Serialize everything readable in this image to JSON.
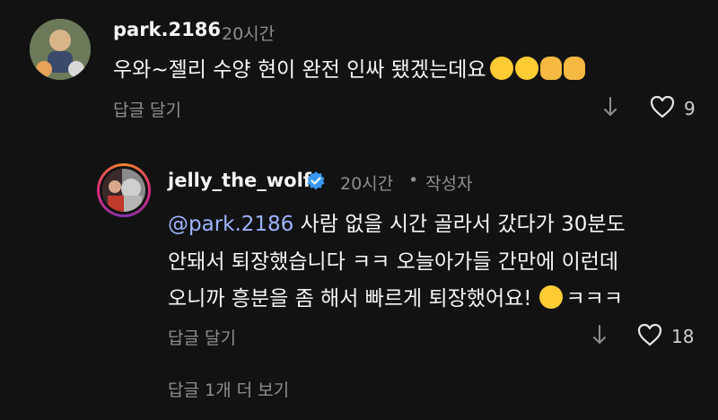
{
  "comment1": {
    "username": "park.2186",
    "time": "20시간",
    "text": "우와~젤리 수양 현이 완전 인싸 됐겠는데요",
    "emojis": [
      "heart-eyes-emoji",
      "heart-eyes-emoji",
      "clapping-hands-emoji",
      "clapping-hands-emoji"
    ],
    "reply_label": "답글 달기",
    "like_count": "9"
  },
  "comment2": {
    "username": "jelly_the_wolf",
    "time": "20시간",
    "author_badge": "작성자",
    "mention": "@park.2186",
    "line1_rest": " 사람 없을 시간 골라서 갔다가 30분도",
    "line2": "안돼서 퇴장했습니다 ㅋㅋ 오늘아가들 간만에 이런데",
    "line3": "오니까 흥분을 좀 해서  빠르게 퇴장했어요!",
    "line3_tail": "ㅋㅋㅋ",
    "reply_label": "답글 달기",
    "like_count": "18"
  },
  "more_replies": "답글 1개 더 보기",
  "colors": {
    "background": "#121212",
    "mention": "#9db4ff",
    "verified": "#3897f0",
    "muted": "#8e8e8e"
  }
}
